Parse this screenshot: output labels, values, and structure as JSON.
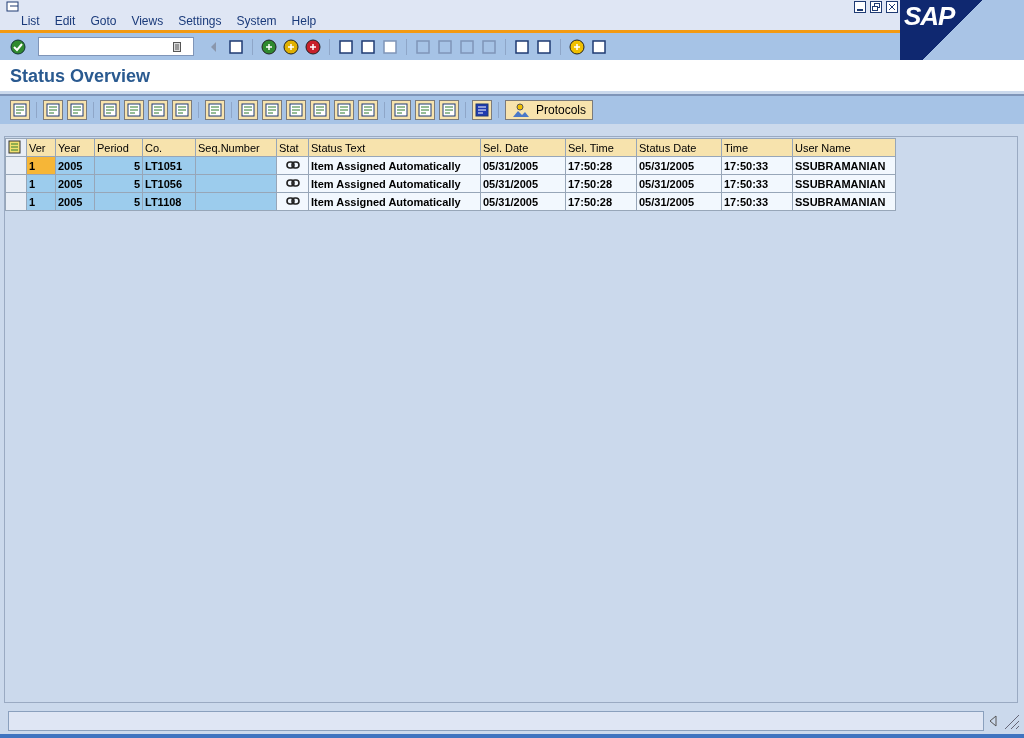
{
  "menu": [
    "List",
    "Edit",
    "Goto",
    "Views",
    "Settings",
    "System",
    "Help"
  ],
  "logo_text": "SAP",
  "title": "Status Overview",
  "protocols_button": "Protocols",
  "table": {
    "columns": [
      {
        "label": "Ver",
        "kind": "key"
      },
      {
        "label": "Year",
        "kind": "key"
      },
      {
        "label": "Period",
        "kind": "keynum"
      },
      {
        "label": "Co.",
        "kind": "key"
      },
      {
        "label": "Seq.Number",
        "kind": "key"
      },
      {
        "label": "Stat",
        "kind": "icon"
      },
      {
        "label": "Status Text",
        "kind": "text"
      },
      {
        "label": "Sel. Date",
        "kind": "text"
      },
      {
        "label": "Sel. Time",
        "kind": "text"
      },
      {
        "label": "Status Date",
        "kind": "text"
      },
      {
        "label": "Time",
        "kind": "text"
      },
      {
        "label": "User Name",
        "kind": "text"
      }
    ],
    "rows": [
      {
        "current": true,
        "cells": [
          "1",
          "2005",
          "5",
          "LT1051",
          null,
          null,
          "Item Assigned Automatically",
          "05/31/2005",
          "17:50:28",
          "05/31/2005",
          "17:50:33",
          "SSUBRAMANIAN"
        ]
      },
      {
        "current": false,
        "cells": [
          "1",
          "2005",
          "5",
          "LT1056",
          null,
          null,
          "Item Assigned Automatically",
          "05/31/2005",
          "17:50:28",
          "05/31/2005",
          "17:50:33",
          "SSUBRAMANIAN"
        ]
      },
      {
        "current": false,
        "cells": [
          "1",
          "2005",
          "5",
          "LT1108",
          null,
          null,
          "Item Assigned Automatically",
          "05/31/2005",
          "17:50:28",
          "05/31/2005",
          "17:50:33",
          "SSUBRAMANIAN"
        ]
      }
    ]
  }
}
